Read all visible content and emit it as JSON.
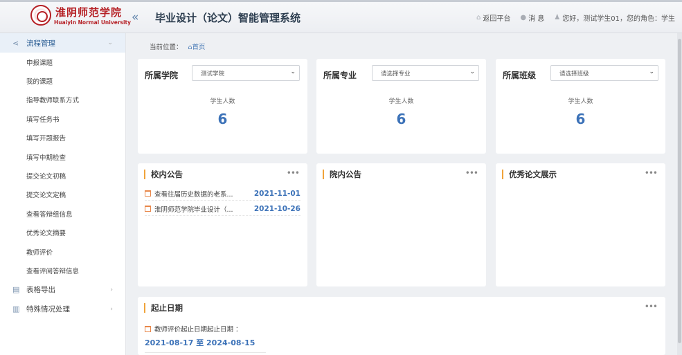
{
  "header": {
    "logo_cn": "淮阴师范学院",
    "logo_en": "Huaiyin Normal University",
    "title": "毕业设计（论文）智能管理系统",
    "return_label": "返回平台",
    "message_label": "消 息",
    "user_label": "您好，测试学生01，您的角色：学生"
  },
  "sidebar": {
    "groups": [
      {
        "label": "流程管理",
        "expanded": true,
        "items": [
          "申报课题",
          "我的课题",
          "指导教师联系方式",
          "填写任务书",
          "填写开题报告",
          "填写中期检查",
          "提交论文初稿",
          "提交论文定稿",
          "查看答辩组信息",
          "优秀论文摘要",
          "教师评价",
          "查看评阅答辩信息"
        ]
      },
      {
        "label": "表格导出"
      },
      {
        "label": "特殊情况处理"
      }
    ]
  },
  "breadcrumb": {
    "label": "当前位置：",
    "home": "首页"
  },
  "stats": [
    {
      "label": "所属学院",
      "select_value": "测试学院",
      "caption": "学生人数",
      "count": "6"
    },
    {
      "label": "所属专业",
      "select_value": "请选择专业",
      "caption": "学生人数",
      "count": "6"
    },
    {
      "label": "所属班级",
      "select_value": "请选择班级",
      "caption": "学生人数",
      "count": "6"
    }
  ],
  "panels": {
    "school_notice": {
      "title": "校内公告",
      "items": [
        {
          "title": "查看往届历史数据的老系...",
          "date": "2021-11-01"
        },
        {
          "title": "淮阴师范学院毕业设计（...",
          "date": "2021-10-26"
        }
      ]
    },
    "college_notice": {
      "title": "院内公告"
    },
    "excellent": {
      "title": "优秀论文展示"
    },
    "deadline": {
      "title": "起止日期",
      "line": "教师评价起止日期起止日期 ：",
      "range": "2021-08-17 至 2024-08-15"
    }
  },
  "more_label": "•••",
  "colors": {
    "accent": "#3c72b8",
    "brand": "#b51f24",
    "marker": "#f0a33a"
  }
}
